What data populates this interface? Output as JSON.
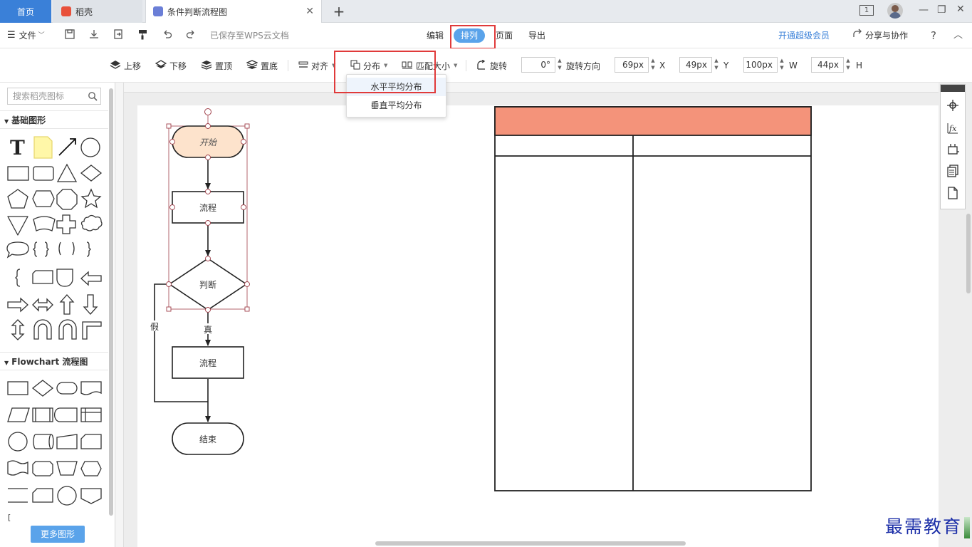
{
  "tabs": {
    "home": "首页",
    "daoke": "稻壳",
    "doc": "条件判断流程图",
    "add": "+"
  },
  "window": {
    "badge": "1"
  },
  "menu": {
    "file": "文件",
    "saved_status": "已保存至WPS云文档",
    "edit": "编辑",
    "arrange": "排列",
    "page": "页面",
    "export": "导出",
    "vip": "开通超级会员",
    "share": "分享与协作",
    "help": "?"
  },
  "toolbar": {
    "move_up": "上移",
    "move_down": "下移",
    "to_top": "置顶",
    "to_bottom": "置底",
    "align": "对齐",
    "distribute": "分布",
    "match_size": "匹配大小",
    "rotate": "旋转",
    "rotate_value": "0°",
    "rotate_direction": "旋转方向",
    "x_value": "69px",
    "x_label": "X",
    "y_value": "49px",
    "y_label": "Y",
    "w_value": "100px",
    "w_label": "W",
    "h_value": "44px",
    "h_label": "H"
  },
  "distribute_menu": {
    "horizontal": "水平平均分布",
    "vertical": "垂直平均分布"
  },
  "sidebar": {
    "search_placeholder": "搜索稻壳图标",
    "category_basic": "基础图形",
    "category_flowchart": "Flowchart 流程图",
    "more_shapes": "更多图形"
  },
  "flowchart": {
    "start": "开始",
    "process1": "流程",
    "decision": "判断",
    "false_label": "假",
    "true_label": "真",
    "process2": "流程",
    "end": "结束"
  },
  "colors": {
    "accent": "#5aa3ea",
    "tab_active": "#3a80d8",
    "highlight_box": "#e03a3a",
    "start_fill": "#fde3cc",
    "table_header": "#f4937a",
    "watermark": "#1c2fa8"
  },
  "watermark": "最需教育"
}
